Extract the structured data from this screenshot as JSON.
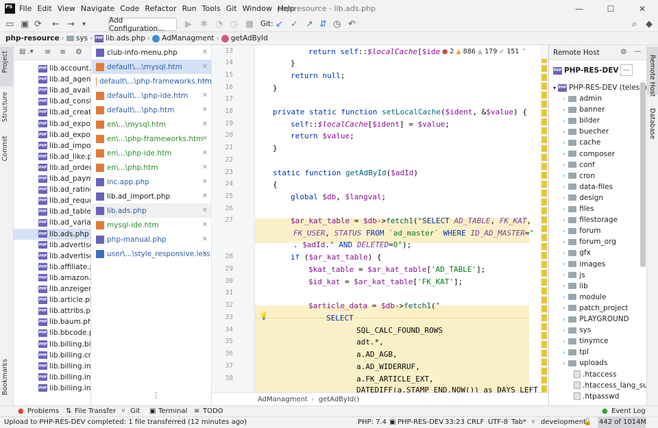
{
  "titlebar": {
    "logo": "PS",
    "menu": [
      "File",
      "Edit",
      "View",
      "Navigate",
      "Code",
      "Refactor",
      "Run",
      "Tools",
      "Git",
      "Window",
      "Help"
    ],
    "title": "php-resource - lib.ads.php"
  },
  "toolbar": {
    "add_config": "Add Configuration...",
    "git_label": "Git:"
  },
  "breadcrumb": {
    "items": [
      "php-resource",
      "sys",
      "lib.ads.php",
      "AdManagment",
      "getAdById"
    ]
  },
  "left_strip": {
    "project": "Project",
    "structure": "Structure",
    "commit": "Commit",
    "bookmarks": "Bookmarks"
  },
  "project_files": [
    "lib.account.ph",
    "lib.ad_agent.p",
    "lib.ad_availabi",
    "lib.ad_constrai",
    "lib.ad_create.p",
    "lib.ad_export.f",
    "lib.ad_export.p",
    "lib.ad_import.p",
    "lib.ad_like.php",
    "lib.ad_order.ph",
    "lib.ad_paymen",
    "lib.ad_rating.p",
    "lib.ad_request.",
    "lib.ad_table.ph",
    "lib.ad_variants",
    "lib.ads.php",
    "lib.advertisem",
    "lib.advertisem",
    "lib.affiliate.php",
    "lib.amazon.php",
    "lib.anzeigen.ph",
    "lib.article.php",
    "lib.attribs.php",
    "lib.baum.php",
    "lib.bbcode.php",
    "lib.billing.billa",
    "lib.billing.cred",
    "lib.billing.invo",
    "lib.billing.invo",
    "lib.billing.invo"
  ],
  "open_tabs": [
    {
      "name": "club-info-menu.php",
      "color": "#1f1f1f",
      "icon": "php"
    },
    {
      "name": "default\\...\\mysql.htm",
      "color": "#2d5cad",
      "icon": "htm"
    },
    {
      "name": "default\\...\\php-frameworks.htm",
      "color": "#2d5cad",
      "icon": "htm"
    },
    {
      "name": "default\\...\\php-ide.htm",
      "color": "#2d5cad",
      "icon": "htm"
    },
    {
      "name": "default\\...\\php.htm",
      "color": "#2d5cad",
      "icon": "htm"
    },
    {
      "name": "en\\...\\mysql.htm",
      "color": "#2f8a2f",
      "icon": "htm"
    },
    {
      "name": "en\\...\\php-frameworks.htm",
      "color": "#2f8a2f",
      "icon": "htm"
    },
    {
      "name": "en\\...\\php-ide.htm",
      "color": "#2f8a2f",
      "icon": "htm"
    },
    {
      "name": "en\\...\\php.htm",
      "color": "#2f8a2f",
      "icon": "htm"
    },
    {
      "name": "inc.app.php",
      "color": "#2d5cad",
      "icon": "php"
    },
    {
      "name": "lib.ad_import.php",
      "color": "#1f1f1f",
      "icon": "php"
    },
    {
      "name": "lib.ads.php",
      "color": "#2d5cad",
      "icon": "php"
    },
    {
      "name": "mysql-ide.htm",
      "color": "#2f8a2f",
      "icon": "htm"
    },
    {
      "name": "php-manual.php",
      "color": "#2d5cad",
      "icon": "php"
    },
    {
      "name": "user\\...\\style_responsive.less",
      "color": "#2d5cad",
      "icon": "less"
    }
  ],
  "editor": {
    "line_numbers": [
      "13",
      "14",
      "15",
      "16",
      "17",
      "18",
      "19",
      "20",
      "21",
      "22",
      "23",
      "24",
      "25",
      "26",
      "27",
      "",
      "",
      "28",
      "29",
      "30",
      "31",
      "32",
      "33",
      "34",
      "35",
      "36",
      "37",
      "38"
    ],
    "inspection": {
      "errors": "2",
      "warnings": "886",
      "weak": "179",
      "typos": "151"
    }
  },
  "code_crumbs": [
    "AdManagment",
    "getAdById()"
  ],
  "remote": {
    "title": "Remote Host",
    "server": "PHP-RES-DEV",
    "root": "PHP-RES-DEV (telesto.ebiz",
    "folders": [
      "admin",
      "banner",
      "bilder",
      "buecher",
      "cache",
      "composer",
      "conf",
      "cron",
      "data-files",
      "design",
      "files",
      "filestorage",
      "forum",
      "forum_org",
      "gfx",
      "images",
      "js",
      "lib",
      "module",
      "patch_project",
      "PLAYGROUND",
      "sys",
      "tinymce",
      "tpl",
      "uploads"
    ],
    "files": [
      ".htaccess",
      ".htaccess_lang_subdir",
      ".htpasswd"
    ]
  },
  "right_strip": {
    "remote": "Remote Host",
    "database": "Database"
  },
  "bottom_tabs": [
    "Problems",
    "File Transfer",
    "Git",
    "Terminal",
    "TODO"
  ],
  "event_log": "Event Log",
  "status": {
    "message": "Upload to PHP-RES-DEV completed: 1 file transferred (12 minutes ago)",
    "php": "PHP: 7.4",
    "server": "PHP-RES-DEV",
    "position": "33:23",
    "line_sep": "CRLF",
    "encoding": "UTF-8",
    "indent": "Tab*",
    "branch": "development",
    "memory": "442 of 1014M"
  }
}
